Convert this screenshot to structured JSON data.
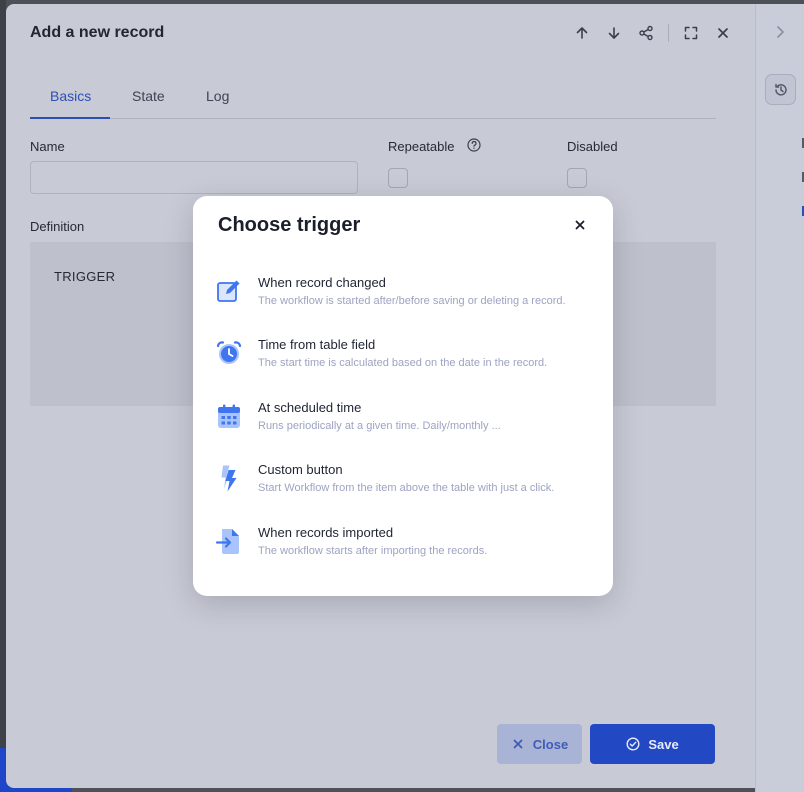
{
  "panel": {
    "title": "Add a new record",
    "tabs": [
      {
        "label": "Basics",
        "active": true
      },
      {
        "label": "State",
        "active": false
      },
      {
        "label": "Log",
        "active": false
      }
    ],
    "fields": {
      "name_label": "Name",
      "name_value": "",
      "repeatable_label": "Repeatable",
      "disabled_label": "Disabled",
      "definition_label": "Definition",
      "trigger_label": "TRIGGER"
    },
    "footer": {
      "close_label": "Close",
      "save_label": "Save"
    }
  },
  "modal": {
    "title": "Choose trigger",
    "options": [
      {
        "title": "When record changed",
        "description": "The workflow is started after/before saving or deleting a record.",
        "icon": "edit-icon"
      },
      {
        "title": "Time from table field",
        "description": "The start time is calculated based on the date in the record.",
        "icon": "alarm-clock-icon"
      },
      {
        "title": "At scheduled time",
        "description": "Runs periodically at a given time. Daily/monthly ...",
        "icon": "calendar-icon"
      },
      {
        "title": "Custom button",
        "description": "Start Workflow from the item above the table with just a click.",
        "icon": "lightning-icon"
      },
      {
        "title": "When records imported",
        "description": "The workflow starts after importing the records.",
        "icon": "file-import-icon"
      }
    ]
  },
  "colors": {
    "accent": "#2348c4",
    "icon_primary": "#3f76ef",
    "icon_light": "#a9c3fb",
    "overlay_panel": "#c8cad5"
  }
}
